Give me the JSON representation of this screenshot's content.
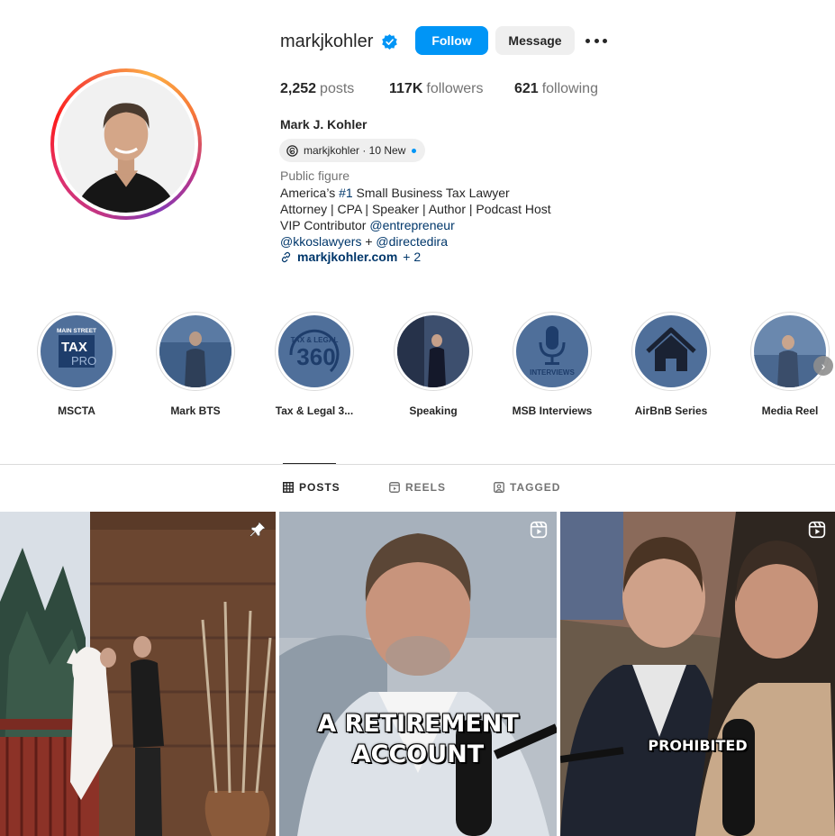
{
  "profile": {
    "username": "markjkohler",
    "follow_label": "Follow",
    "message_label": "Message",
    "stats": {
      "posts_count": "2,252",
      "posts_label": "posts",
      "followers_count": "117K",
      "followers_label": "followers",
      "following_count": "621",
      "following_label": "following"
    },
    "full_name": "Mark J. Kohler",
    "threads_badge": "markjkohler · 10 New",
    "category": "Public figure",
    "bio": {
      "line1_prefix": "America’s ",
      "line1_hashtag": "#1",
      "line1_suffix": " Small Business Tax Lawyer",
      "line2": "Attorney | CPA | Speaker | Author | Podcast Host",
      "line3_prefix": "VIP Contributor ",
      "line3_mention": "@entrepreneur",
      "line4_mention1": "@kkoslawyers",
      "line4_sep": " + ",
      "line4_mention2": "@directedira"
    },
    "link": {
      "text": "markjkohler.com",
      "extra": "+ 2"
    }
  },
  "highlights": [
    {
      "label": "MSCTA",
      "icon": "tax-pro-logo"
    },
    {
      "label": "Mark BTS",
      "icon": "photo"
    },
    {
      "label": "Tax & Legal 3...",
      "icon": "tax-legal-360-logo"
    },
    {
      "label": "Speaking",
      "icon": "photo"
    },
    {
      "label": "MSB Interviews",
      "icon": "microphone-icon"
    },
    {
      "label": "AirBnB Series",
      "icon": "house-icon"
    },
    {
      "label": "Media Reel",
      "icon": "photo"
    }
  ],
  "highlight_texts": {
    "taxpro_top": "MAIN STREET",
    "taxpro_tax": "TAX",
    "taxpro_pro": "PRO",
    "taxlegal_top": "TAX & LEGAL",
    "taxlegal_num": "360",
    "interviews": "INTERVIEWS"
  },
  "tabs": [
    {
      "label": "POSTS",
      "icon": "grid-icon",
      "active": true
    },
    {
      "label": "REELS",
      "icon": "reels-icon",
      "active": false
    },
    {
      "label": "TAGGED",
      "icon": "tagged-icon",
      "active": false
    }
  ],
  "posts": [
    {
      "type": "image",
      "badge": "pin-icon",
      "caption": ""
    },
    {
      "type": "reel",
      "badge": "reels-icon",
      "caption_line1": "A RETIREMENT",
      "caption_line2": "ACCOUNT"
    },
    {
      "type": "reel",
      "badge": "reels-icon",
      "caption": "PROHIBITED"
    }
  ],
  "colors": {
    "accent": "#0095f6",
    "link": "#00376b",
    "secondary_text": "#737373",
    "highlight_bg": "#4f6f9a"
  }
}
